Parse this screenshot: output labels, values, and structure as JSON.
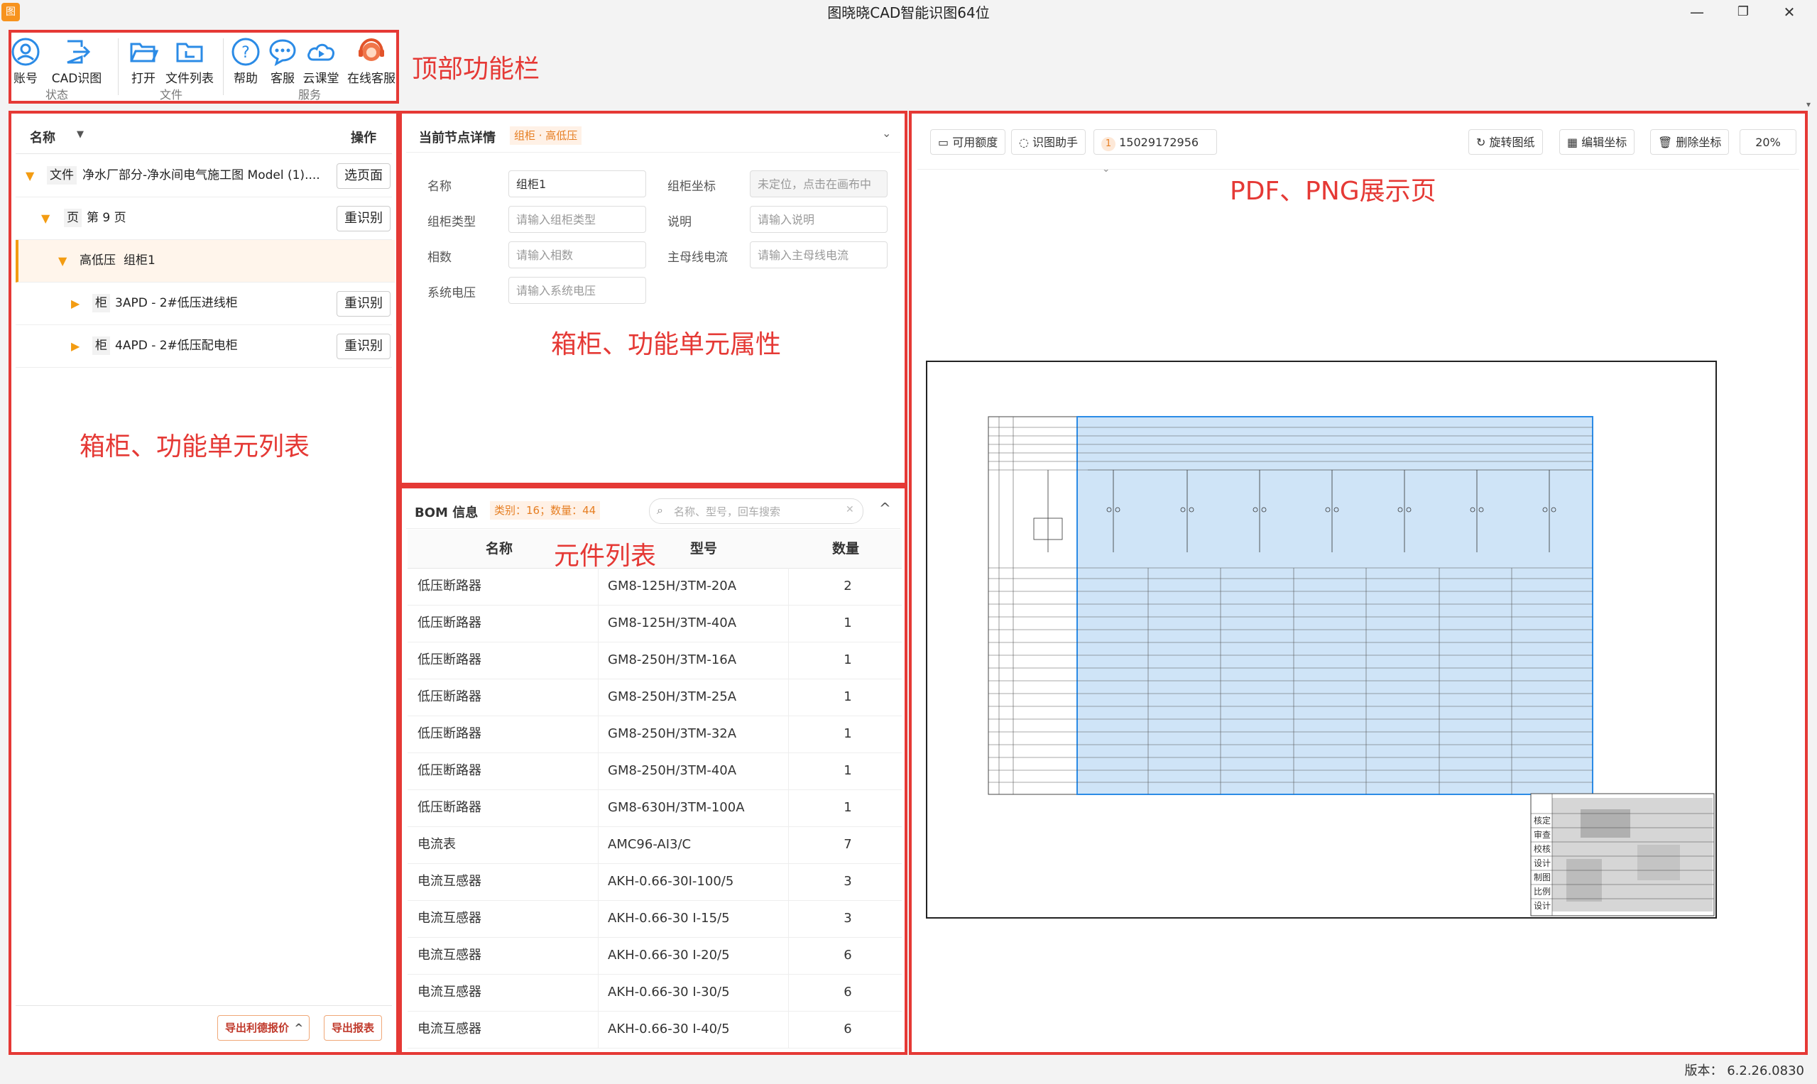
{
  "window": {
    "title": "图晓晓CAD智能识图64位",
    "min": "—",
    "max": "❐",
    "close": "✕"
  },
  "toolbar": {
    "items": [
      {
        "label": "账号",
        "icon": "user-icon"
      },
      {
        "label": "CAD识图",
        "icon": "export-icon"
      },
      {
        "label": "打开",
        "icon": "folder-open-icon"
      },
      {
        "label": "文件列表",
        "icon": "folder-list-icon"
      },
      {
        "label": "帮助",
        "icon": "help-icon"
      },
      {
        "label": "客服",
        "icon": "chat-icon"
      },
      {
        "label": "云课堂",
        "icon": "cloud-class-icon"
      },
      {
        "label": "在线客服",
        "icon": "agent-icon"
      }
    ],
    "groups": [
      "状态",
      "文件",
      "服务"
    ]
  },
  "annotations": {
    "toolbar": "顶部功能栏",
    "left": "箱柜、功能单元列表",
    "mid_top": "箱柜、功能单元属性",
    "mid_bot": "元件列表",
    "right": "PDF、PNG展示页"
  },
  "tree": {
    "col_name": "名称",
    "col_action": "操作",
    "rows": [
      {
        "tag": "文件",
        "text": "净水厂部分-净水间电气施工图 Model (1)....",
        "action": "选页面"
      },
      {
        "tag": "页",
        "text": "第 9 页",
        "action": "重识别"
      },
      {
        "tag": "高低压",
        "text": "组柜1",
        "action": ""
      },
      {
        "tag": "柜",
        "text": "3APD - 2#低压进线柜",
        "action": "重识别"
      },
      {
        "tag": "柜",
        "text": "4APD - 2#低压配电柜",
        "action": "重识别"
      }
    ],
    "export_quote": "导出利德报价",
    "export_report": "导出报表"
  },
  "node_detail": {
    "title": "当前节点详情",
    "badge": "组柜 · 高低压",
    "fields": [
      {
        "label": "名称",
        "value": "组柜1",
        "placeholder": ""
      },
      {
        "label": "组柜坐标",
        "value": "",
        "placeholder": "未定位，点击在画布中"
      },
      {
        "label": "组柜类型",
        "value": "",
        "placeholder": "请输入组柜类型"
      },
      {
        "label": "说明",
        "value": "",
        "placeholder": "请输入说明"
      },
      {
        "label": "相数",
        "value": "",
        "placeholder": "请输入相数"
      },
      {
        "label": "主母线电流",
        "value": "",
        "placeholder": "请输入主母线电流"
      },
      {
        "label": "系统电压",
        "value": "",
        "placeholder": "请输入系统电压"
      }
    ]
  },
  "bom": {
    "title": "BOM 信息",
    "stats": "类别：16；数量：44",
    "search_placeholder": "名称、型号，回车搜索",
    "headers": [
      "名称",
      "型号",
      "数量"
    ],
    "rows": [
      [
        "低压断路器",
        "GM8-125H/3TM-20A",
        "2"
      ],
      [
        "低压断路器",
        "GM8-125H/3TM-40A",
        "1"
      ],
      [
        "低压断路器",
        "GM8-250H/3TM-16A",
        "1"
      ],
      [
        "低压断路器",
        "GM8-250H/3TM-25A",
        "1"
      ],
      [
        "低压断路器",
        "GM8-250H/3TM-32A",
        "1"
      ],
      [
        "低压断路器",
        "GM8-250H/3TM-40A",
        "1"
      ],
      [
        "低压断路器",
        "GM8-630H/3TM-100A",
        "1"
      ],
      [
        "电流表",
        "AMC96-AI3/C",
        "7"
      ],
      [
        "电流互感器",
        "AKH-0.66-30I-100/5",
        "3"
      ],
      [
        "电流互感器",
        "AKH-0.66-30 I-15/5",
        "3"
      ],
      [
        "电流互感器",
        "AKH-0.66-30 I-20/5",
        "6"
      ],
      [
        "电流互感器",
        "AKH-0.66-30 I-30/5",
        "6"
      ],
      [
        "电流互感器",
        "AKH-0.66-30 I-40/5",
        "6"
      ]
    ]
  },
  "viewer": {
    "buttons": {
      "quota": "可用额度",
      "assistant": "识图助手",
      "phone": "15029172956",
      "phone_badge": "1",
      "rotate": "旋转图纸",
      "edit_coord": "编辑坐标",
      "delete_coord": "删除坐标",
      "zoom": "20%"
    },
    "drawing_labels": [
      "核定",
      "审查",
      "校核",
      "设计",
      "制图",
      "比例",
      "设计"
    ]
  },
  "status": {
    "version": "版本： 6.2.26.0830"
  }
}
